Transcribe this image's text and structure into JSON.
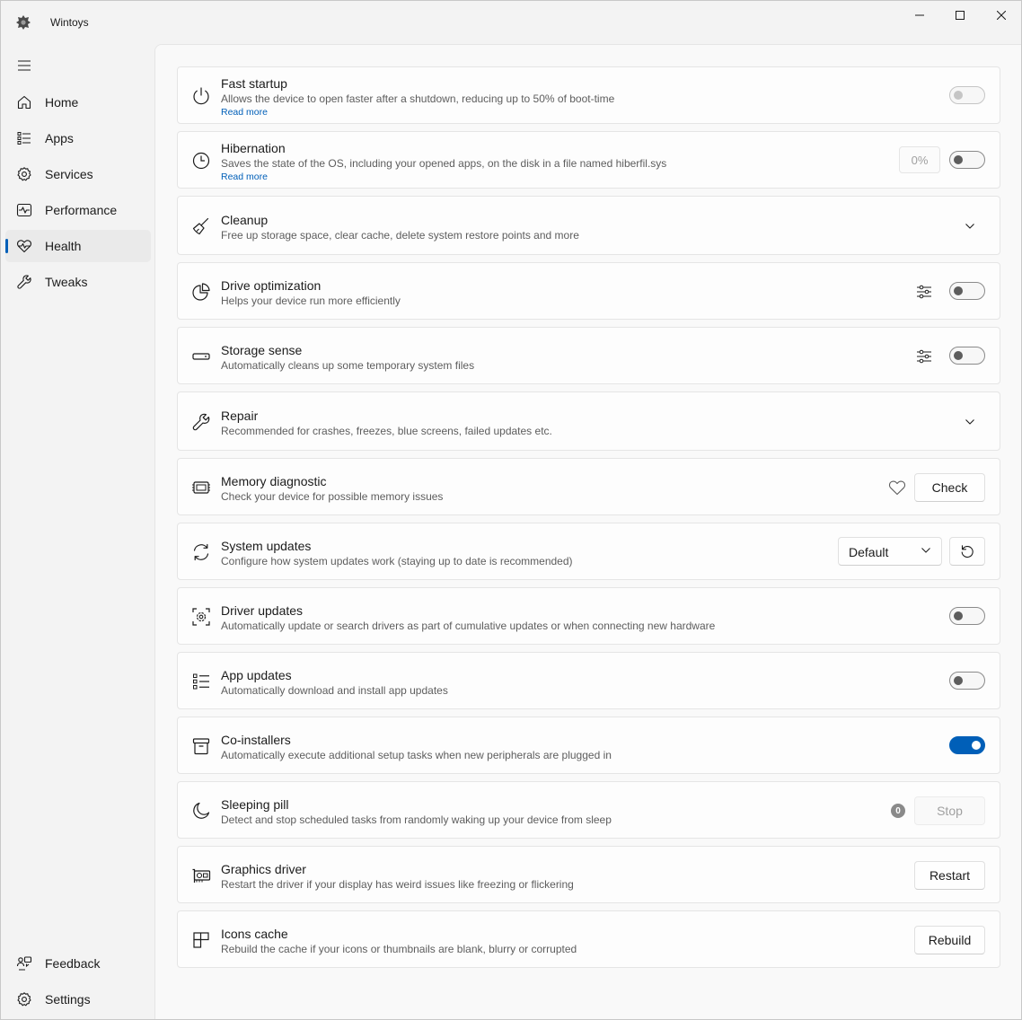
{
  "window": {
    "title": "Wintoys"
  },
  "colors": {
    "accent": "#005fb8",
    "background": "#f3f3f3",
    "card": "#fdfdfd"
  },
  "sidebar": {
    "items": [
      {
        "label": "Home",
        "icon": "home-icon"
      },
      {
        "label": "Apps",
        "icon": "apps-list-icon"
      },
      {
        "label": "Services",
        "icon": "services-gear-icon"
      },
      {
        "label": "Performance",
        "icon": "performance-pulse-icon"
      },
      {
        "label": "Health",
        "icon": "health-heartbeat-icon",
        "selected": true
      },
      {
        "label": "Tweaks",
        "icon": "wrench-icon"
      }
    ],
    "footer": [
      {
        "label": "Feedback",
        "icon": "feedback-icon"
      },
      {
        "label": "Settings",
        "icon": "settings-gear-icon"
      }
    ]
  },
  "cards": {
    "fast_startup": {
      "title": "Fast startup",
      "desc": "Allows the device to open faster after a shutdown, reducing up to 50% of boot-time",
      "link": "Read more",
      "toggle": false,
      "disabled": true
    },
    "hibernation": {
      "title": "Hibernation",
      "desc": "Saves the state of the OS, including your opened apps, on the disk in a file named hiberfil.sys",
      "link": "Read more",
      "percent": "0%",
      "toggle": false
    },
    "cleanup": {
      "title": "Cleanup",
      "desc": "Free up storage space, clear cache, delete system restore points and more"
    },
    "drive_optimization": {
      "title": "Drive optimization",
      "desc": "Helps your device run more efficiently",
      "toggle": false
    },
    "storage_sense": {
      "title": "Storage sense",
      "desc": "Automatically cleans up some temporary system files",
      "toggle": false
    },
    "repair": {
      "title": "Repair",
      "desc": "Recommended for crashes, freezes, blue screens, failed updates etc."
    },
    "memory_diagnostic": {
      "title": "Memory diagnostic",
      "desc": "Check your device for possible memory issues",
      "button": "Check"
    },
    "system_updates": {
      "title": "System updates",
      "desc": "Configure how system updates work (staying up to date is recommended)",
      "select": "Default"
    },
    "driver_updates": {
      "title": "Driver updates",
      "desc": "Automatically update or search drivers as part of cumulative updates or when connecting new hardware",
      "toggle": false
    },
    "app_updates": {
      "title": "App updates",
      "desc": "Automatically download and install app updates",
      "toggle": false
    },
    "co_installers": {
      "title": "Co-installers",
      "desc": "Automatically execute additional setup tasks when new peripherals are plugged in",
      "toggle": true
    },
    "sleeping_pill": {
      "title": "Sleeping pill",
      "desc": "Detect and stop scheduled tasks from randomly waking up your device from sleep",
      "count": "0",
      "button": "Stop",
      "disabled": true
    },
    "graphics_driver": {
      "title": "Graphics driver",
      "desc": "Restart the driver if your display has weird issues like freezing or flickering",
      "button": "Restart"
    },
    "icons_cache": {
      "title": "Icons cache",
      "desc": "Rebuild the cache if your icons or thumbnails are blank, blurry or corrupted",
      "button": "Rebuild"
    }
  }
}
